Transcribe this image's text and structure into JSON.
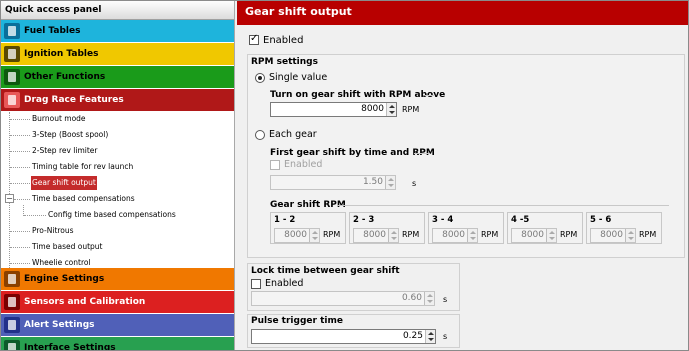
{
  "sidebar": {
    "header": "Quick access panel",
    "categories_top": [
      {
        "label": "Fuel Tables",
        "color": "#1eb4dc",
        "icon": "fuel-table-icon"
      },
      {
        "label": "Ignition Tables",
        "color": "#f0c800",
        "icon": "ignition-table-icon"
      },
      {
        "label": "Other Functions",
        "color": "#1a9b1a",
        "icon": "other-functions-icon"
      },
      {
        "label": "Drag Race Features",
        "color": "#b01818",
        "icon": "drag-race-icon"
      }
    ],
    "tree": [
      "Burnout mode",
      "3-Step (Boost spool)",
      "2-Step rev limiter",
      "Timing table for rev launch",
      "Gear shift output",
      "Time based compensations",
      "Config time based compensations",
      "Pro-Nitrous",
      "Time based output",
      "Wheelie control"
    ],
    "categories_bottom": [
      {
        "label": "Engine Settings",
        "color": "#f07800",
        "icon": "engine-icon"
      },
      {
        "label": "Sensors and Calibration",
        "color": "#dc2020",
        "icon": "sensor-icon"
      },
      {
        "label": "Alert Settings",
        "color": "#5060b8",
        "icon": "alert-icon"
      },
      {
        "label": "Interface Settings",
        "color": "#28a050",
        "icon": "interface-icon"
      }
    ]
  },
  "main": {
    "title": "Gear shift output",
    "enabled_label": "Enabled",
    "rpm_settings": "RPM settings",
    "single_value": "Single value",
    "turn_on_label": "Turn on gear shift with RPM above",
    "turn_on_value": "8000",
    "rpm_unit": "RPM",
    "each_gear": "Each gear",
    "first_gear_label": "First gear shift by time and RPM",
    "first_gear_enabled": "Enabled",
    "first_gear_time": "1.50",
    "sec_unit": "s",
    "gear_shift_rpm": "Gear shift RPM",
    "gears": [
      {
        "label": "1 - 2",
        "value": "8000"
      },
      {
        "label": "2 - 3",
        "value": "8000"
      },
      {
        "label": "3 - 4",
        "value": "8000"
      },
      {
        "label": "4 -5",
        "value": "8000"
      },
      {
        "label": "5 - 6",
        "value": "8000"
      }
    ],
    "lock_label": "Lock time between gear shift",
    "lock_enabled": "Enabled",
    "lock_value": "0.60",
    "pulse_label": "Pulse trigger time",
    "pulse_value": "0.25"
  }
}
